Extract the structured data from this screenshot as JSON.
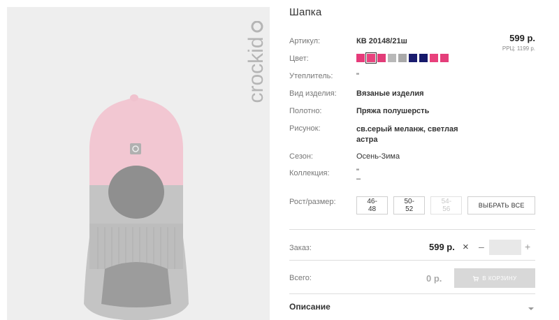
{
  "brand": {
    "logo_text": "crockid"
  },
  "product": {
    "title": "Шапка",
    "price": "599 р.",
    "rrc": "РРЦ: 1199 р.",
    "fields": [
      {
        "label": "Артикул:",
        "value": "КВ 20148/21ш"
      },
      {
        "label": "Цвет:",
        "value": ""
      },
      {
        "label": "Утеплитель:",
        "value": "\""
      },
      {
        "label": "Вид изделия:",
        "value": "Вязаные изделия"
      },
      {
        "label": "Полотно:",
        "value": "Пряжа полушерсть"
      },
      {
        "label": "Рисунок:",
        "value": "св.серый меланж, светлая астра"
      },
      {
        "label": "Сезон:",
        "value": "Осень-Зима"
      },
      {
        "label": "Коллекция:",
        "value": "\""
      },
      {
        "label": "Рост/размер:",
        "value": ""
      }
    ],
    "collection_dash": "–",
    "colors": [
      {
        "hex": "#e63b7a",
        "selected": false
      },
      {
        "hex": "#e8437e",
        "selected": true
      },
      {
        "hex": "#e23c78",
        "selected": false
      },
      {
        "hex": "#b8b8b8",
        "selected": false
      },
      {
        "hex": "#a9a9a9",
        "selected": false
      },
      {
        "hex": "#1a1c6e",
        "selected": false
      },
      {
        "hex": "#16196a",
        "selected": false
      },
      {
        "hex": "#e8417c",
        "selected": false
      },
      {
        "hex": "#e43e7a",
        "selected": false
      }
    ],
    "sizes": [
      {
        "label": "46-48",
        "available": true
      },
      {
        "label": "50-52",
        "available": true
      },
      {
        "label": "54-56",
        "available": false
      }
    ],
    "select_all_label": "ВЫБРАТЬ ВСЕ"
  },
  "order": {
    "label": "Заказ:",
    "price": "599 р.",
    "times": "×",
    "minus": "–",
    "plus": "+",
    "quantity": ""
  },
  "total": {
    "label": "Всего:",
    "value": "0 р.",
    "cart_button": "В КОРЗИНУ",
    "cart_icon": "cart-icon"
  },
  "description": {
    "title": "Описание",
    "icon": "chevron-down-icon"
  }
}
